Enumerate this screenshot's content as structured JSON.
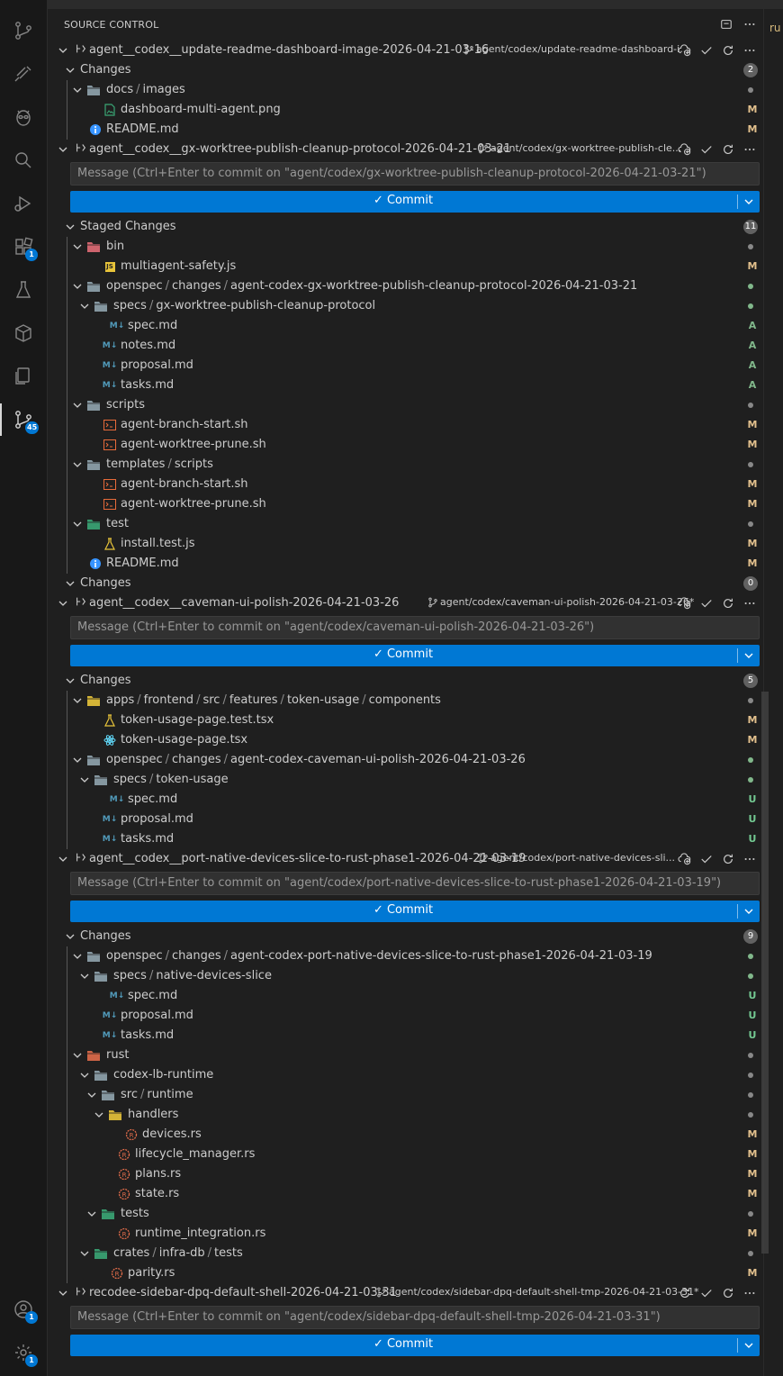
{
  "header": {
    "title": "SOURCE CONTROL"
  },
  "right_peek": "ru",
  "activity_bar": {
    "items": [
      {
        "name": "source-control-icon"
      },
      {
        "name": "github-icon"
      },
      {
        "name": "alien-icon"
      },
      {
        "name": "search-icon"
      },
      {
        "name": "run-debug-icon"
      },
      {
        "name": "extensions-icon",
        "badge": "1"
      },
      {
        "name": "testing-icon"
      },
      {
        "name": "remote-explorer-icon"
      },
      {
        "name": "copy-icon"
      },
      {
        "name": "source-control-graph-icon",
        "badge": "45"
      }
    ],
    "accounts_badge": "1",
    "settings_badge": "1"
  },
  "repos": [
    {
      "name": "agent__codex__update-readme-dashboard-image-2026-04-21-03-16",
      "branch": "agent/codex/update-readme-dashboard-i...",
      "groups": [
        {
          "title": "Changes",
          "count": "2",
          "items": [
            {
              "type": "folder",
              "parts": [
                "docs",
                "images"
              ],
              "depth": 1
            },
            {
              "type": "file",
              "name": "dashboard-multi-agent.png",
              "depth": 2,
              "status": "M",
              "icon": "image"
            },
            {
              "type": "file",
              "name": "README.md",
              "depth": 1,
              "status": "M",
              "icon": "info"
            }
          ]
        }
      ]
    },
    {
      "name": "agent__codex__gx-worktree-publish-cleanup-protocol-2026-04-21-03-21",
      "branch": "agent/codex/gx-worktree-publish-cle...",
      "message_placeholder": "Message (Ctrl+Enter to commit on \"agent/codex/gx-worktree-publish-cleanup-protocol-2026-04-21-03-21\")",
      "commit_label": "Commit",
      "groups": [
        {
          "title": "Staged Changes",
          "count": "11",
          "items": [
            {
              "type": "folder",
              "parts": [
                "bin"
              ],
              "depth": 1,
              "icon": "bin"
            },
            {
              "type": "file",
              "name": "multiagent-safety.js",
              "depth": 2,
              "status": "M",
              "icon": "js"
            },
            {
              "type": "folder",
              "parts": [
                "openspec",
                "changes",
                "agent-codex-gx-worktree-publish-cleanup-protocol-2026-04-21-03-21"
              ],
              "depth": 1,
              "dotGreen": true
            },
            {
              "type": "folder",
              "parts": [
                "specs",
                "gx-worktree-publish-cleanup-protocol"
              ],
              "depth": 2,
              "dotGreen": true
            },
            {
              "type": "file",
              "name": "spec.md",
              "depth": 3,
              "status": "A",
              "icon": "md"
            },
            {
              "type": "file",
              "name": "notes.md",
              "depth": 2,
              "status": "A",
              "icon": "md"
            },
            {
              "type": "file",
              "name": "proposal.md",
              "depth": 2,
              "status": "A",
              "icon": "md"
            },
            {
              "type": "file",
              "name": "tasks.md",
              "depth": 2,
              "status": "A",
              "icon": "md"
            },
            {
              "type": "folder",
              "parts": [
                "scripts"
              ],
              "depth": 1
            },
            {
              "type": "file",
              "name": "agent-branch-start.sh",
              "depth": 2,
              "status": "M",
              "icon": "sh"
            },
            {
              "type": "file",
              "name": "agent-worktree-prune.sh",
              "depth": 2,
              "status": "M",
              "icon": "sh"
            },
            {
              "type": "folder",
              "parts": [
                "templates",
                "scripts"
              ],
              "depth": 1
            },
            {
              "type": "file",
              "name": "agent-branch-start.sh",
              "depth": 2,
              "status": "M",
              "icon": "sh"
            },
            {
              "type": "file",
              "name": "agent-worktree-prune.sh",
              "depth": 2,
              "status": "M",
              "icon": "sh"
            },
            {
              "type": "folder",
              "parts": [
                "test"
              ],
              "depth": 1,
              "icon": "test"
            },
            {
              "type": "file",
              "name": "install.test.js",
              "depth": 2,
              "status": "M",
              "icon": "flask"
            },
            {
              "type": "file",
              "name": "README.md",
              "depth": 1,
              "status": "M",
              "icon": "info"
            }
          ]
        },
        {
          "title": "Changes",
          "count": "0",
          "items": []
        }
      ]
    },
    {
      "name": "agent__codex__caveman-ui-polish-2026-04-21-03-26",
      "branch": "agent/codex/caveman-ui-polish-2026-04-21-03-26*",
      "message_placeholder": "Message (Ctrl+Enter to commit on \"agent/codex/caveman-ui-polish-2026-04-21-03-26\")",
      "commit_label": "Commit",
      "groups": [
        {
          "title": "Changes",
          "count": "5",
          "items": [
            {
              "type": "folder",
              "parts": [
                "apps",
                "frontend",
                "src",
                "features",
                "token-usage",
                "components"
              ],
              "depth": 1,
              "icon": "apps"
            },
            {
              "type": "file",
              "name": "token-usage-page.test.tsx",
              "depth": 2,
              "status": "M",
              "icon": "flask"
            },
            {
              "type": "file",
              "name": "token-usage-page.tsx",
              "depth": 2,
              "status": "M",
              "icon": "react"
            },
            {
              "type": "folder",
              "parts": [
                "openspec",
                "changes",
                "agent-codex-caveman-ui-polish-2026-04-21-03-26"
              ],
              "depth": 1,
              "dotGreen": true
            },
            {
              "type": "folder",
              "parts": [
                "specs",
                "token-usage"
              ],
              "depth": 2,
              "dotGreen": true
            },
            {
              "type": "file",
              "name": "spec.md",
              "depth": 3,
              "status": "U",
              "icon": "md"
            },
            {
              "type": "file",
              "name": "proposal.md",
              "depth": 2,
              "status": "U",
              "icon": "md"
            },
            {
              "type": "file",
              "name": "tasks.md",
              "depth": 2,
              "status": "U",
              "icon": "md"
            }
          ]
        }
      ]
    },
    {
      "name": "agent__codex__port-native-devices-slice-to-rust-phase1-2026-04-21-03-19",
      "branch": "agent/codex/port-native-devices-sli...",
      "message_placeholder": "Message (Ctrl+Enter to commit on \"agent/codex/port-native-devices-slice-to-rust-phase1-2026-04-21-03-19\")",
      "commit_label": "Commit",
      "groups": [
        {
          "title": "Changes",
          "count": "9",
          "items": [
            {
              "type": "folder",
              "parts": [
                "openspec",
                "changes",
                "agent-codex-port-native-devices-slice-to-rust-phase1-2026-04-21-03-19"
              ],
              "depth": 1,
              "dotGreen": true
            },
            {
              "type": "folder",
              "parts": [
                "specs",
                "native-devices-slice"
              ],
              "depth": 2,
              "dotGreen": true
            },
            {
              "type": "file",
              "name": "spec.md",
              "depth": 3,
              "status": "U",
              "icon": "md"
            },
            {
              "type": "file",
              "name": "proposal.md",
              "depth": 2,
              "status": "U",
              "icon": "md"
            },
            {
              "type": "file",
              "name": "tasks.md",
              "depth": 2,
              "status": "U",
              "icon": "md"
            },
            {
              "type": "folder",
              "parts": [
                "rust"
              ],
              "depth": 1,
              "icon": "rust"
            },
            {
              "type": "folder",
              "parts": [
                "codex-lb-runtime"
              ],
              "depth": 2
            },
            {
              "type": "folder",
              "parts": [
                "src",
                "runtime"
              ],
              "depth": 3
            },
            {
              "type": "folder",
              "parts": [
                "handlers"
              ],
              "depth": 4,
              "icon": "handlers"
            },
            {
              "type": "file",
              "name": "devices.rs",
              "depth": 5,
              "status": "M",
              "icon": "rs"
            },
            {
              "type": "file",
              "name": "lifecycle_manager.rs",
              "depth": 4,
              "status": "M",
              "icon": "rs"
            },
            {
              "type": "file",
              "name": "plans.rs",
              "depth": 4,
              "status": "M",
              "icon": "rs"
            },
            {
              "type": "file",
              "name": "state.rs",
              "depth": 4,
              "status": "M",
              "icon": "rs"
            },
            {
              "type": "folder",
              "parts": [
                "tests"
              ],
              "depth": 3,
              "icon": "test"
            },
            {
              "type": "file",
              "name": "runtime_integration.rs",
              "depth": 4,
              "status": "M",
              "icon": "rs"
            },
            {
              "type": "folder",
              "parts": [
                "crates",
                "infra-db",
                "tests"
              ],
              "depth": 2,
              "icon": "test"
            },
            {
              "type": "file",
              "name": "parity.rs",
              "depth": 3,
              "status": "M",
              "icon": "rs"
            }
          ]
        }
      ]
    },
    {
      "name": "recodee-sidebar-dpq-default-shell-2026-04-21-03-31",
      "branch": "agent/codex/sidebar-dpq-default-shell-tmp-2026-04-21-03-31*",
      "message_placeholder": "Message (Ctrl+Enter to commit on \"agent/codex/sidebar-dpq-default-shell-tmp-2026-04-21-03-31\")",
      "commit_label": "Commit",
      "groups": []
    }
  ]
}
